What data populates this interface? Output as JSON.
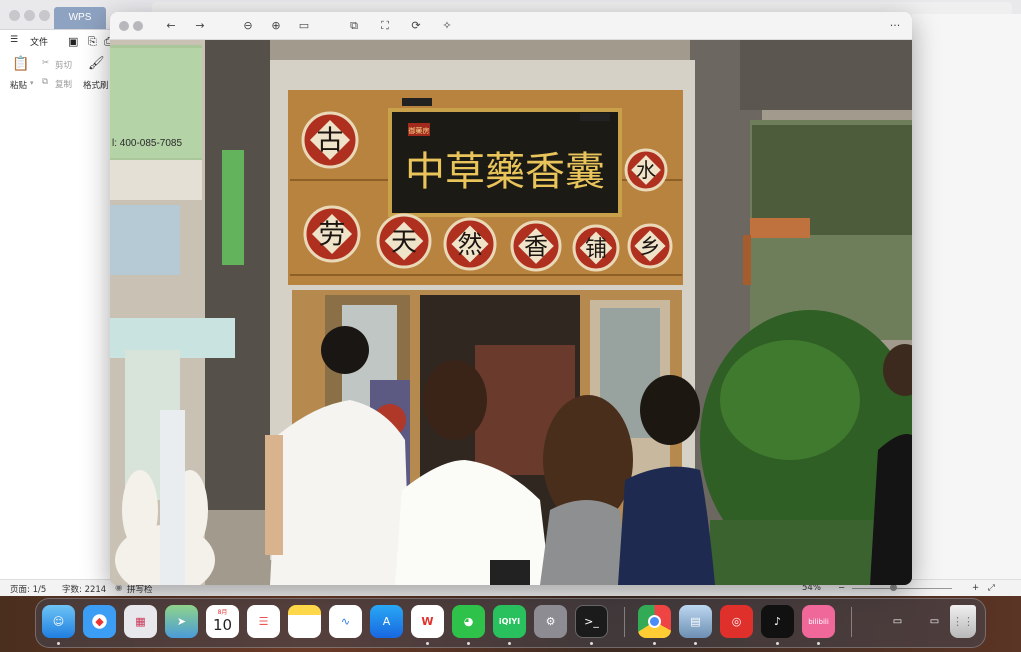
{
  "wps": {
    "tab_label": "WPS",
    "menu_file": "文件",
    "ribbon": {
      "paste": "粘贴",
      "cut": "剪切",
      "copy": "复制",
      "format_painter": "格式刷"
    },
    "status": {
      "page": "页面: 1/5",
      "word_count": "字数: 2214",
      "spell_check": "拼写检",
      "zoom": "54%"
    }
  },
  "viewer": {
    "toolbar_icons": [
      "back-icon",
      "forward-icon",
      "zoom-out-icon",
      "zoom-in-icon",
      "fit-icon",
      "resize-icon",
      "crop-icon",
      "rotate-icon",
      "enhance-icon",
      "more-icon"
    ]
  },
  "photo": {
    "sign_main": "中草藥香囊",
    "sign_small": "御藥房",
    "phone": "l: 400-085-7085",
    "medallions_top": [
      "古",
      "水"
    ],
    "medallions_row": [
      "劳",
      "天",
      "然",
      "香",
      "铺",
      "乡"
    ]
  },
  "dock": {
    "calendar_month": "8月",
    "calendar_day": "10",
    "iqiyi": "iQIYI",
    "bilibili": "bilibili",
    "apps": [
      "Finder",
      "Safari",
      "Launchpad",
      "Maps",
      "Calendar",
      "Reminders",
      "Notes",
      "Freeform",
      "App Store",
      "WPS Office",
      "WeChat",
      "iQIYI",
      "System Settings",
      "Terminal",
      "Chrome",
      "Preview",
      "NetEase Music",
      "TikTok",
      "bilibili",
      "Downloads",
      "Documents",
      "Trash"
    ]
  }
}
